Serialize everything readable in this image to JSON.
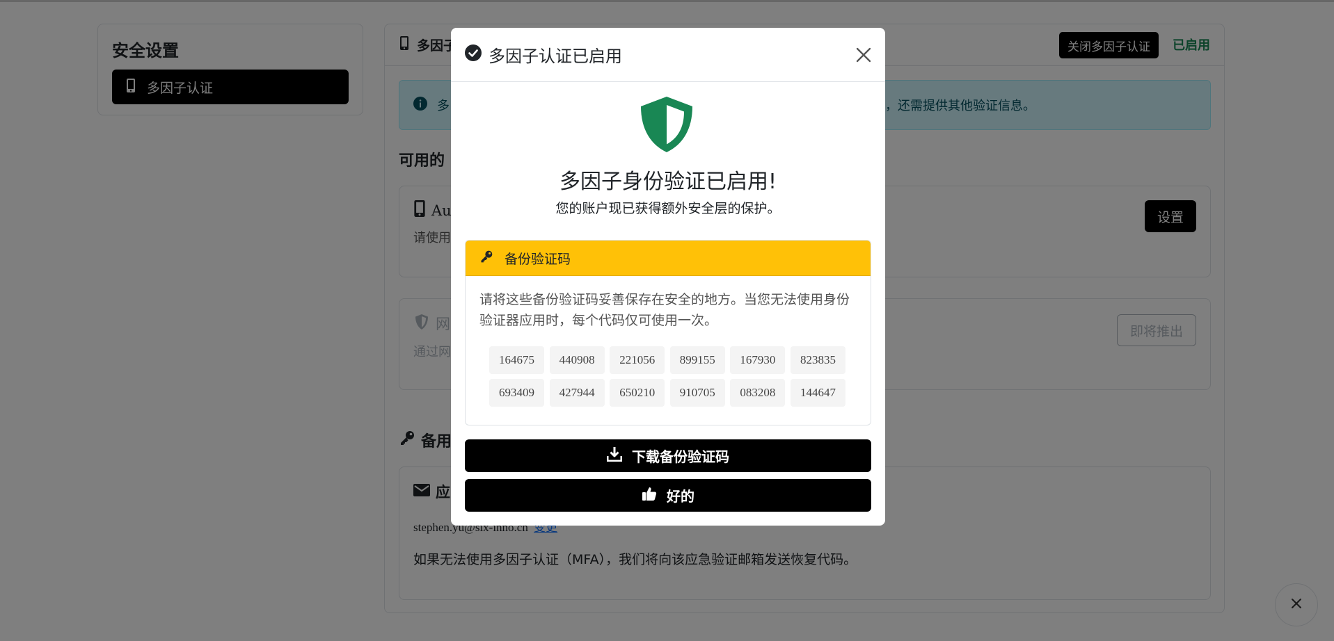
{
  "sidebar": {
    "title": "安全设置",
    "items": [
      {
        "label": "多因子认证",
        "icon": "mobile-icon",
        "active": true
      }
    ]
  },
  "main": {
    "header_title": "多因子",
    "disable_button": "关闭多因子认证",
    "status": "已启用",
    "status_color": "#198754",
    "info_prefix": "多",
    "info_suffix": "，还需提供其他验证信息。",
    "methods_title": "可用的",
    "authenticator": {
      "title": "Au",
      "desc": "请使用",
      "setup_button": "设置"
    },
    "webauthn": {
      "title": "网",
      "desc": "通过网",
      "soon_button": "即将推出"
    },
    "backup_section_title": "备用",
    "emergency": {
      "title": "应",
      "email": "stephen.yu@six-inno.cn",
      "change_link": "变更",
      "note": "如果无法使用多因子认证（MFA），我们将向该应急验证邮箱发送恢复代码。"
    }
  },
  "modal": {
    "title": "多因子认证已启用",
    "heading": "多因子身份验证已启用!",
    "subtext": "您的账户现已获得额外安全层的保护。",
    "backup_header": "备份验证码",
    "backup_header_color": "#ffc107",
    "backup_note": "请将这些备份验证码妥善保存在安全的地方。当您无法使用身份验证器应用时，每个代码仅可使用一次。",
    "codes": [
      "164675",
      "440908",
      "221056",
      "899155",
      "167930",
      "823835",
      "693409",
      "427944",
      "650210",
      "910705",
      "083208",
      "144647"
    ],
    "download_button": "下载备份验证码",
    "ok_button": "好的",
    "shield_color": "#198754"
  }
}
